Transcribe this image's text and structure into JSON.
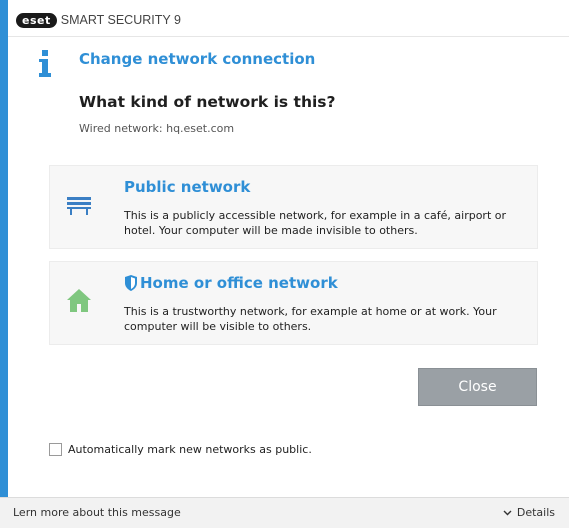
{
  "window": {
    "brand_logo": "eset",
    "product_name": "SMART SECURITY 9"
  },
  "header": {
    "title": "Change network connection",
    "icon": "info-icon"
  },
  "main": {
    "question": "What kind of network is this?",
    "network_line": "Wired network: hq.eset.com"
  },
  "options": [
    {
      "title": "Public network",
      "description": "This is a publicly accessible network, for example in a café, airport or hotel. Your computer will be made invisible to others.",
      "icon": "bench-icon"
    },
    {
      "title": "Home or office network",
      "description": "This is a trustworthy network, for example at home or at work. Your computer will be visible to others.",
      "icon": "house-icon",
      "badge_icon": "shield-icon"
    }
  ],
  "actions": {
    "close_label": "Close"
  },
  "settings": {
    "auto_mark_label": "Automatically mark new networks as public.",
    "auto_mark_checked": false
  },
  "footer": {
    "learn_more": "Lern more about this message",
    "details_label": "Details"
  },
  "colors": {
    "accent": "#2f8fd6",
    "close_button": "#9aa0a5",
    "house_green": "#7fc77f",
    "bench_blue": "#3b7fc4"
  }
}
